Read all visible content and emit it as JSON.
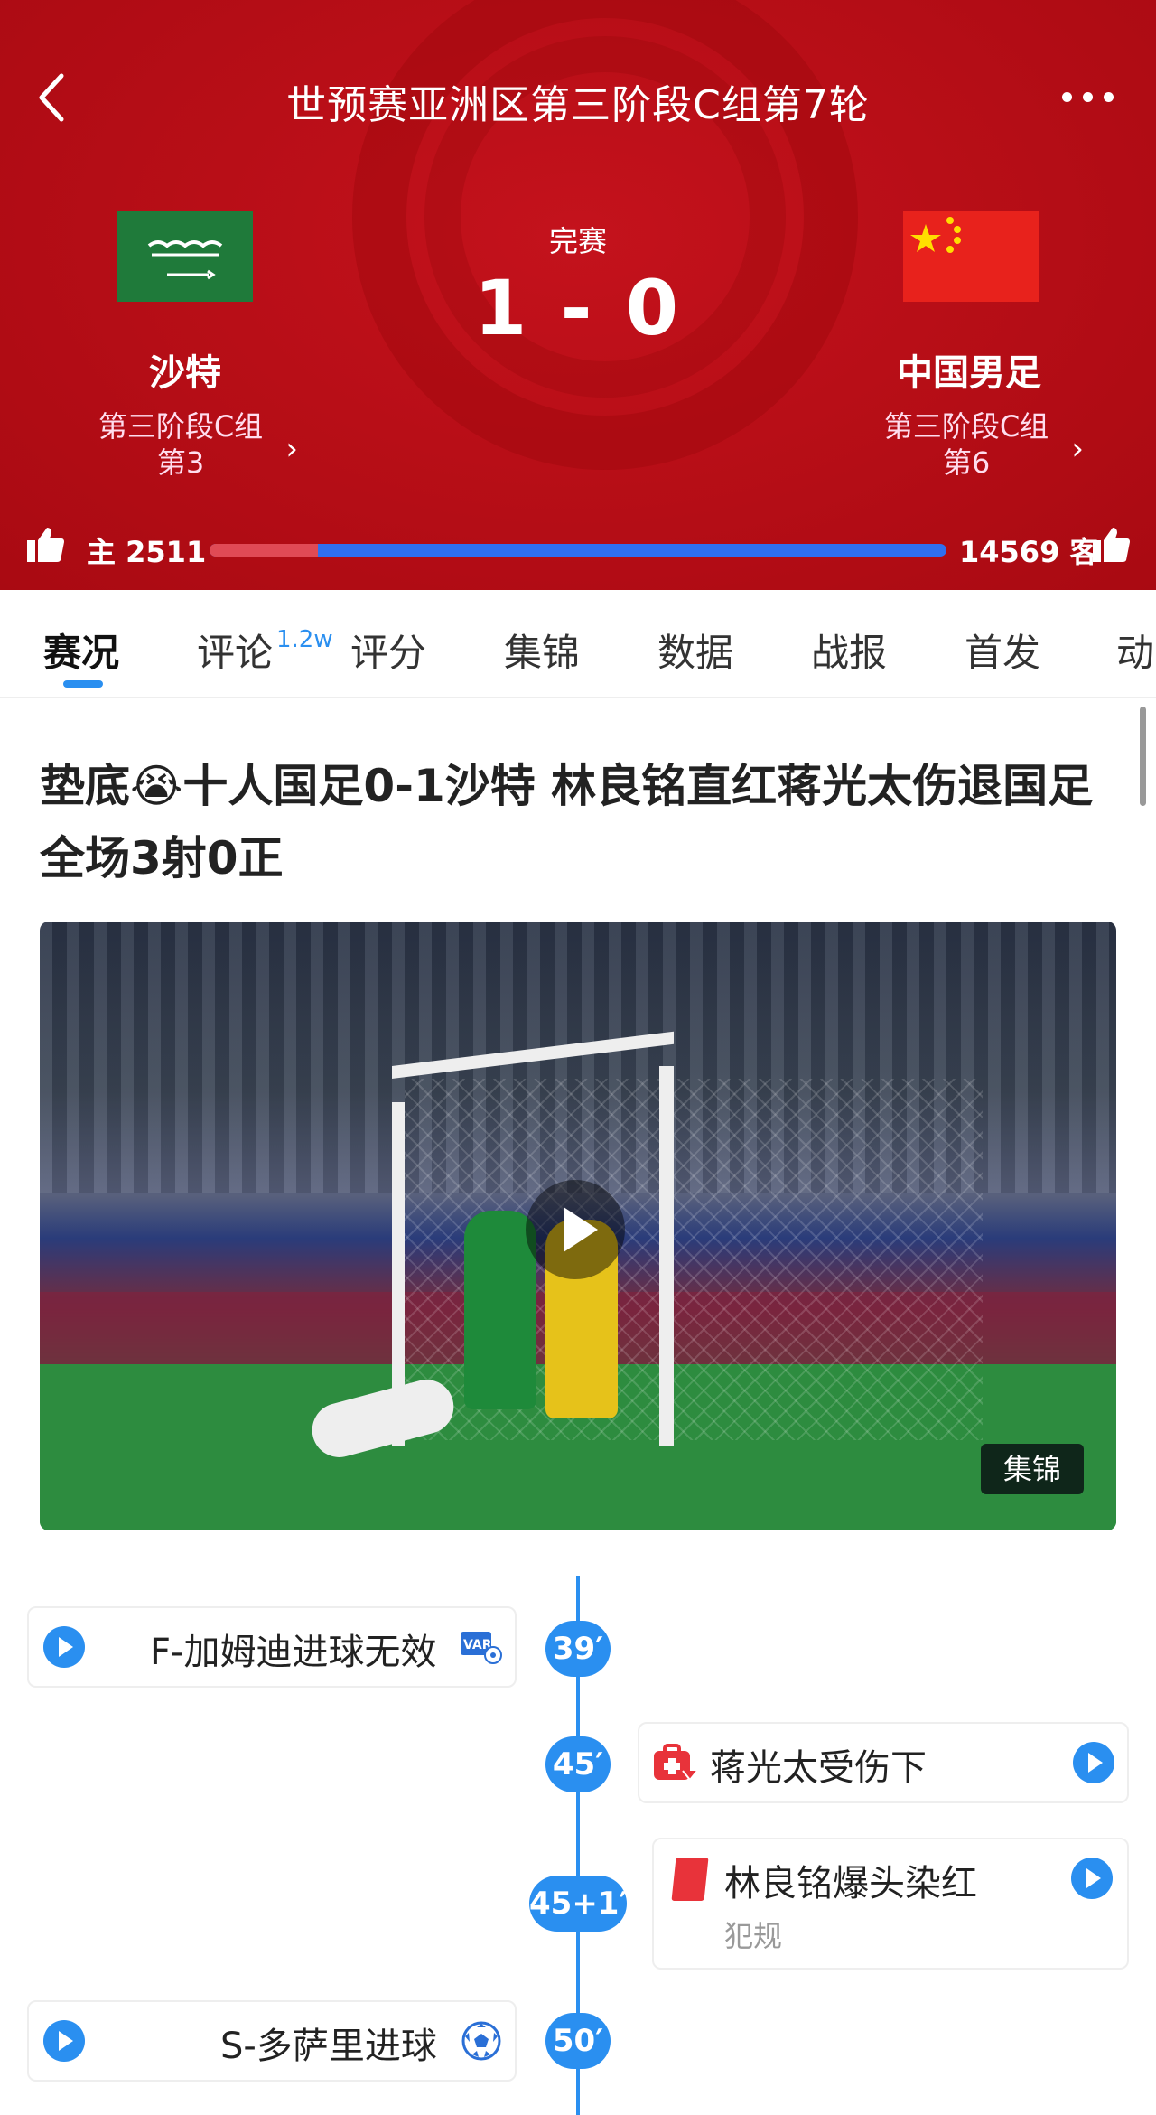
{
  "match": {
    "title": "世预赛亚洲区第三阶段C组第7轮",
    "status": "完赛",
    "score": "1 - 0",
    "home": {
      "name": "沙特",
      "rank_line1": "第三阶段C组",
      "rank_line2": "第3"
    },
    "away": {
      "name": "中国男足",
      "rank_line1": "第三阶段C组",
      "rank_line2": "第6"
    },
    "votes": {
      "home_label": "主 2511",
      "away_label": "14569 客",
      "home_count": 2511,
      "away_count": 14569
    }
  },
  "tabs": [
    {
      "label": "赛况"
    },
    {
      "label": "评论"
    },
    {
      "label": "评分"
    },
    {
      "label": "集锦"
    },
    {
      "label": "数据"
    },
    {
      "label": "战报"
    },
    {
      "label": "首发"
    },
    {
      "label": "动"
    }
  ],
  "comment_badge": "1.2w",
  "article": {
    "headline": "垫底😭十人国足0-1沙特 林良铭直红蒋光太伤退国足全场3射0正",
    "video_tag": "集锦"
  },
  "timeline": [
    {
      "minute": "39′",
      "side": "home",
      "text": "F-加姆迪进球无效",
      "icon": "var-icon"
    },
    {
      "minute": "45′",
      "side": "away",
      "text": "蒋光太受伤下",
      "icon": "injury-icon"
    },
    {
      "minute": "45+1′",
      "side": "away",
      "text": "林良铭爆头染红",
      "sub": "犯规",
      "icon": "red-card-icon"
    },
    {
      "minute": "50′",
      "side": "home",
      "text": "S-多萨里进球",
      "icon": "football-icon"
    }
  ],
  "colors": {
    "header_red": "#b80e17",
    "accent_blue": "#2a8ff0",
    "home_vote": "#e04a55",
    "away_vote": "#2f6ff0",
    "red_card": "#e8333a"
  }
}
